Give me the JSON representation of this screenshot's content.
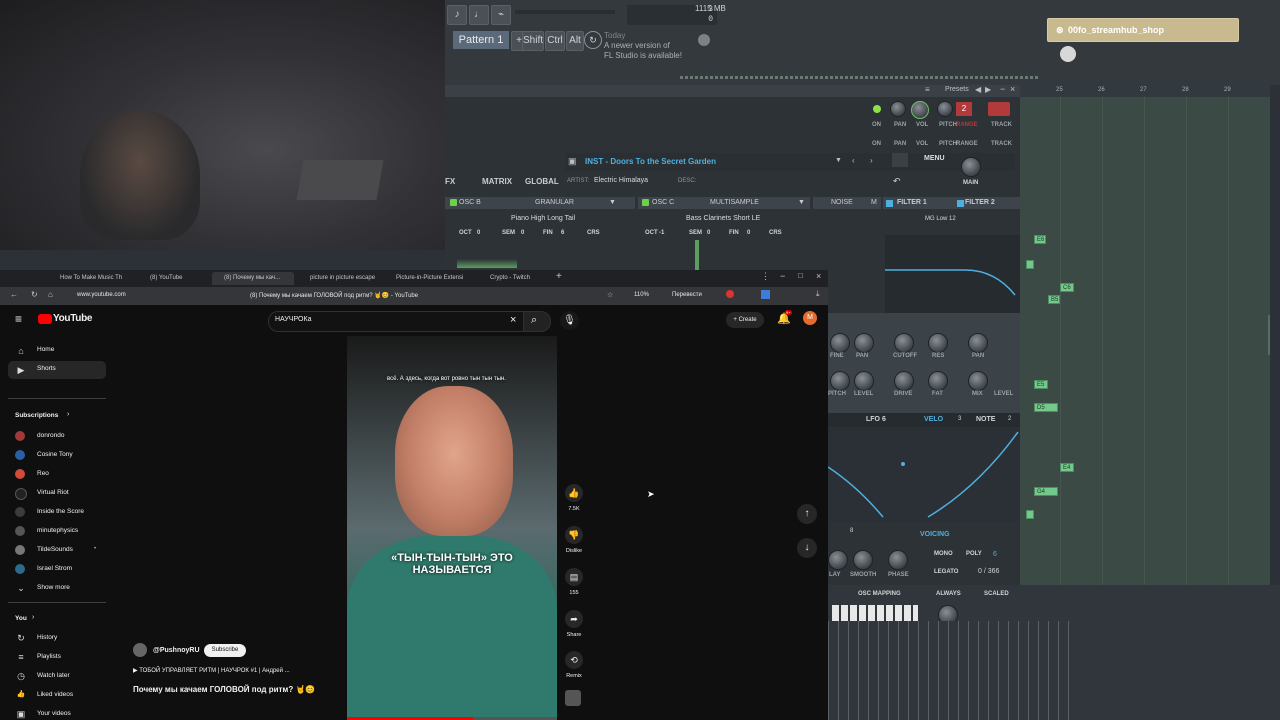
{
  "fl_studio": {
    "pattern_label": "Pattern 1",
    "modifier_keys": [
      "Shift",
      "Ctrl",
      "Alt"
    ],
    "news_line1": "Today",
    "news_line2": "A newer version of",
    "news_line3": "FL Studio is available!",
    "memory": "1115 MB",
    "counter_top": "3",
    "counter_bottom": "0",
    "presets_label": "Presets",
    "header_controls": {
      "on": "ON",
      "pan": "PAN",
      "vol": "VOL",
      "pitch": "PITCH",
      "range": "RANGE",
      "track": "TRACK"
    },
    "range_value": "2"
  },
  "serum": {
    "tabs": [
      "FX",
      "MATRIX",
      "GLOBAL"
    ],
    "preset_name": "INST - Doors To the Secret Garden",
    "artist_label": "ARTIST:",
    "artist": "Electric Himalaya",
    "desc_label": "DESC:",
    "menu_label": "MENU",
    "main_label": "MAIN",
    "osc_b": {
      "label": "OSC B",
      "mode": "GRANULAR",
      "sample": "Piano High Long Tail",
      "oct_label": "OCT",
      "oct": "0",
      "sem_label": "SEM",
      "sem": "0",
      "fin_label": "FIN",
      "fin": "6",
      "crs_label": "CRS"
    },
    "osc_c": {
      "label": "OSC C",
      "mode": "MULTISAMPLE",
      "sample": "Bass Clarinets Short LE",
      "oct_label": "OCT",
      "oct": "-1",
      "sem_label": "SEM",
      "sem": "0",
      "fin_label": "FIN",
      "fin": "0",
      "crs_label": "CRS"
    },
    "noise_label": "NOISE",
    "filter1_label": "FILTER 1",
    "filter1_type": "MG Low 12",
    "filter2_label": "FILTER 2",
    "filter_knobs": [
      "FINE",
      "PAN",
      "CUTOFF",
      "RES",
      "PAN",
      "PITCH",
      "LEVEL",
      "DRIVE",
      "FAT",
      "MIX",
      "LEVEL"
    ],
    "mod_tabs": [
      "LFO 6",
      "VELO",
      "3",
      "NOTE",
      "2"
    ],
    "lfo_value": "8",
    "lfo_knobs": [
      "LAY",
      "SMOOTH",
      "PHASE"
    ],
    "voicing_label": "VOICING",
    "mono_label": "MONO",
    "poly_label": "POLY",
    "poly_value": "6",
    "legato_label": "LEGATO",
    "legato_value": "0 / 366",
    "osc_mapping_label": "OSC MAPPING",
    "always_label": "ALWAYS",
    "scaled_label": "SCALED"
  },
  "piano_roll": {
    "bar_numbers": [
      "25",
      "26",
      "27",
      "28",
      "29"
    ],
    "notes": [
      "E6",
      "C6",
      "B5",
      "E5",
      "D5",
      "E4",
      "G4"
    ]
  },
  "stream_badge": {
    "name": "00fo_streamhub_shop"
  },
  "browser": {
    "tabs": [
      "How To Make Music Th",
      "(8) YouTube",
      "(8) Почему мы кач...",
      "picture in picture escape",
      "Picture-in-Picture Extensi",
      "Crypto - Twitch"
    ],
    "url": "www.youtube.com",
    "page_title": "(8) Почему мы качаем ГОЛОВОЙ под ритм? 🤘😊 - YouTube",
    "zoom": "110%",
    "translate_label": "Перевести"
  },
  "youtube": {
    "logo": "YouTube",
    "search_value": "НАУЧРОКа",
    "create_label": "Create",
    "notification_count": "9+",
    "account_initial": "M",
    "nav": [
      {
        "icon": "home-icon",
        "label": "Home",
        "glyph": "⌂"
      },
      {
        "icon": "shorts-icon",
        "label": "Shorts",
        "glyph": "▶"
      }
    ],
    "subscriptions_label": "Subscriptions",
    "subscriptions": [
      {
        "label": "donrondo",
        "color": "#a03a3a"
      },
      {
        "label": "Cosine Tony",
        "color": "#2a5fa8"
      },
      {
        "label": "Reo",
        "color": "#d14a3a"
      },
      {
        "label": "Virtual Riot",
        "color": "#222222"
      },
      {
        "label": "Inside the Score",
        "color": "#3c3c3c"
      },
      {
        "label": "minutephysics",
        "color": "#555555"
      },
      {
        "label": "TildeSounds",
        "color": "#777777"
      },
      {
        "label": "Israel Strom",
        "color": "#2c6b8c"
      }
    ],
    "show_more": "Show more",
    "you_label": "You",
    "you_items": [
      {
        "icon": "history-icon",
        "label": "History",
        "glyph": "↻"
      },
      {
        "icon": "playlists-icon",
        "label": "Playlists",
        "glyph": "≡"
      },
      {
        "icon": "watch-later-icon",
        "label": "Watch later",
        "glyph": "◷"
      },
      {
        "icon": "liked-videos-icon",
        "label": "Liked videos",
        "glyph": "👍"
      },
      {
        "icon": "your-videos-icon",
        "label": "Your videos",
        "glyph": "▣"
      }
    ],
    "short": {
      "caption_top": "всё. А здесь, когда вот ровно тын тын тын.",
      "caption_main_line1": "«ТЫН-ТЫН-ТЫН» ЭТО",
      "caption_main_line2": "НАЗЫВАЕТСЯ",
      "channel": "@PushnoyRU",
      "subscribe_label": "Subscribe",
      "playlist": "▶ ТОБОЙ УПРАВЛЯЕТ РИТМ | НАУЧРОК #1 | Андрей ...",
      "title": "Почему мы качаем ГОЛОВОЙ под ритм? 🤘😊",
      "likes": "7.5K",
      "dislike_label": "Dislike",
      "comments": "155",
      "share_label": "Share",
      "remix_label": "Remix"
    }
  }
}
